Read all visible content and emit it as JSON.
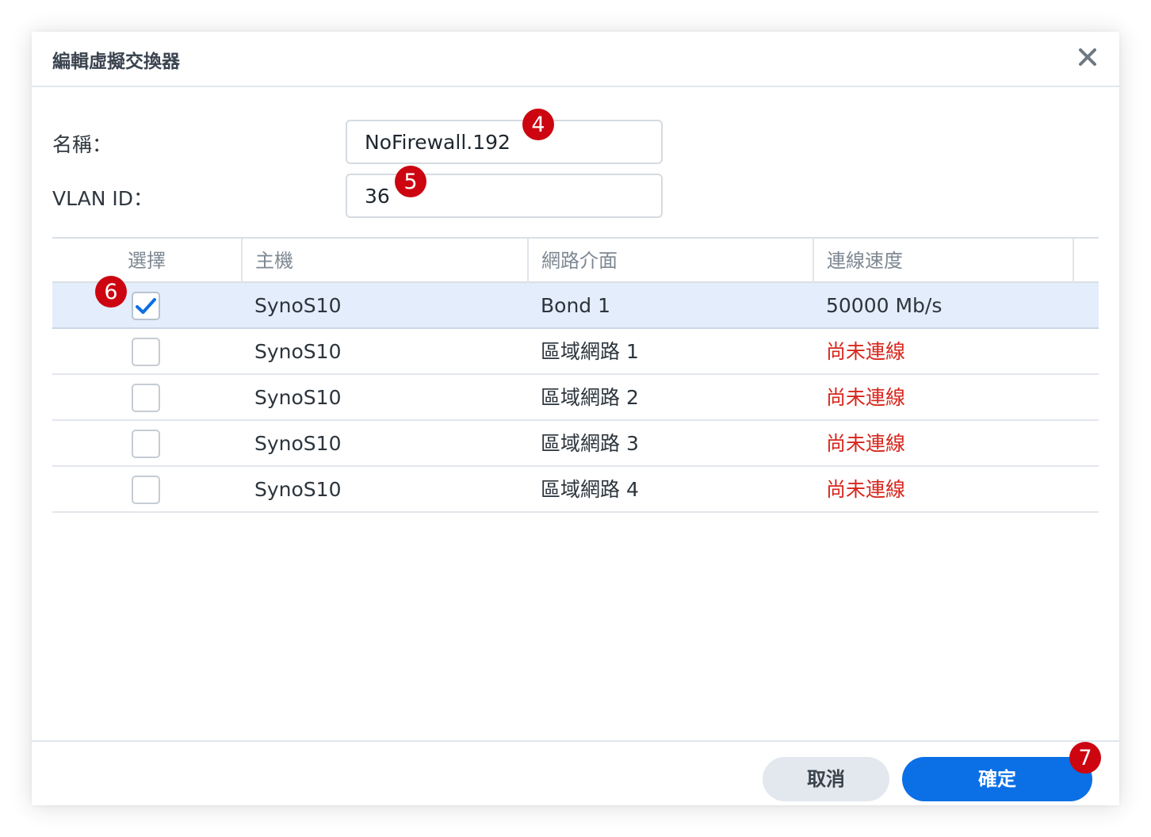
{
  "dialog": {
    "title": "編輯虛擬交換器",
    "close_icon": "close-icon"
  },
  "form": {
    "name_label": "名稱：",
    "name_value": "NoFirewall.192",
    "vlan_label": "VLAN ID：",
    "vlan_value": "36"
  },
  "grid": {
    "columns": [
      "選擇",
      "主機",
      "網路介面",
      "連線速度"
    ],
    "rows": [
      {
        "checked": true,
        "host": "SynoS10",
        "iface": "Bond 1",
        "speed": "50000 Mb/s",
        "speed_status": "connected"
      },
      {
        "checked": false,
        "host": "SynoS10",
        "iface": "區域網路 1",
        "speed": "尚未連線",
        "speed_status": "disconnected"
      },
      {
        "checked": false,
        "host": "SynoS10",
        "iface": "區域網路 2",
        "speed": "尚未連線",
        "speed_status": "disconnected"
      },
      {
        "checked": false,
        "host": "SynoS10",
        "iface": "區域網路 3",
        "speed": "尚未連線",
        "speed_status": "disconnected"
      },
      {
        "checked": false,
        "host": "SynoS10",
        "iface": "區域網路 4",
        "speed": "尚未連線",
        "speed_status": "disconnected"
      }
    ]
  },
  "footer": {
    "cancel_label": "取消",
    "ok_label": "確定"
  },
  "annotations": {
    "badge_name": "4",
    "badge_vlan": "5",
    "badge_select": "6",
    "badge_ok": "7"
  },
  "colors": {
    "accent": "#0b6fe6",
    "error": "#d7261c",
    "badge": "#cc0510",
    "selected_row": "#e4edfb"
  }
}
